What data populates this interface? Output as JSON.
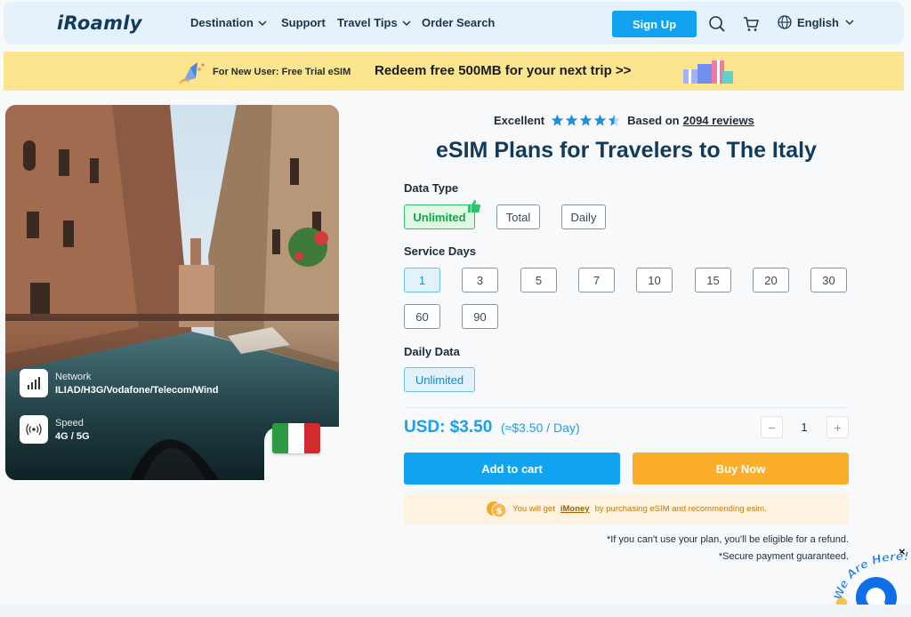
{
  "header": {
    "logo": "iRoamly",
    "nav": [
      "Destination",
      "Support",
      "Travel Tips",
      "Order Search"
    ],
    "signup": "Sign Up",
    "language": "English"
  },
  "promo": {
    "small": "For New User: Free Trial eSIM",
    "big": "Redeem free 500MB for your next trip >>"
  },
  "hero": {
    "network_label": "Network",
    "network_value": "ILIAD/H3G/Vodafone/Telecom/Wind",
    "speed_label": "Speed",
    "speed_value": "4G / 5G",
    "flag_colors": [
      "#2e9a43",
      "#ffffff",
      "#d32a2f"
    ]
  },
  "rating": {
    "label": "Excellent",
    "stars": 4.5,
    "based_on": "Based on",
    "reviews": "2094 reviews"
  },
  "title": "eSIM Plans for Travelers to The Italy",
  "data_type": {
    "label": "Data Type",
    "options": [
      "Unlimited",
      "Total",
      "Daily"
    ],
    "selected": "Unlimited"
  },
  "service_days": {
    "label": "Service Days",
    "options": [
      "1",
      "3",
      "5",
      "7",
      "10",
      "15",
      "20",
      "30",
      "60",
      "90"
    ],
    "selected": "1"
  },
  "daily_data": {
    "label": "Daily Data",
    "options": [
      "Unlimited"
    ],
    "selected": "Unlimited"
  },
  "price": {
    "total": "USD: $3.50",
    "per_day": "(≈$3.50 / Day)",
    "quantity": "1",
    "minus": "−",
    "plus": "+"
  },
  "buttons": {
    "add_to_cart": "Add to cart",
    "buy_now": "Buy Now"
  },
  "imoney": {
    "before": "You will get",
    "link": "iMoney",
    "after": "by purchasing eSIM and recommending esim."
  },
  "notes": [
    "*If you can't use your plan, you'll be eligible for a refund.",
    "*Secure payment guaranteed."
  ],
  "chat": {
    "badge": "We Are Here!",
    "close": "×"
  },
  "colors": {
    "accent_blue": "#12a3f0",
    "buy_orange": "#fbae2c",
    "title_navy": "#123a5a",
    "promo_yellow": "#fbe58e"
  }
}
